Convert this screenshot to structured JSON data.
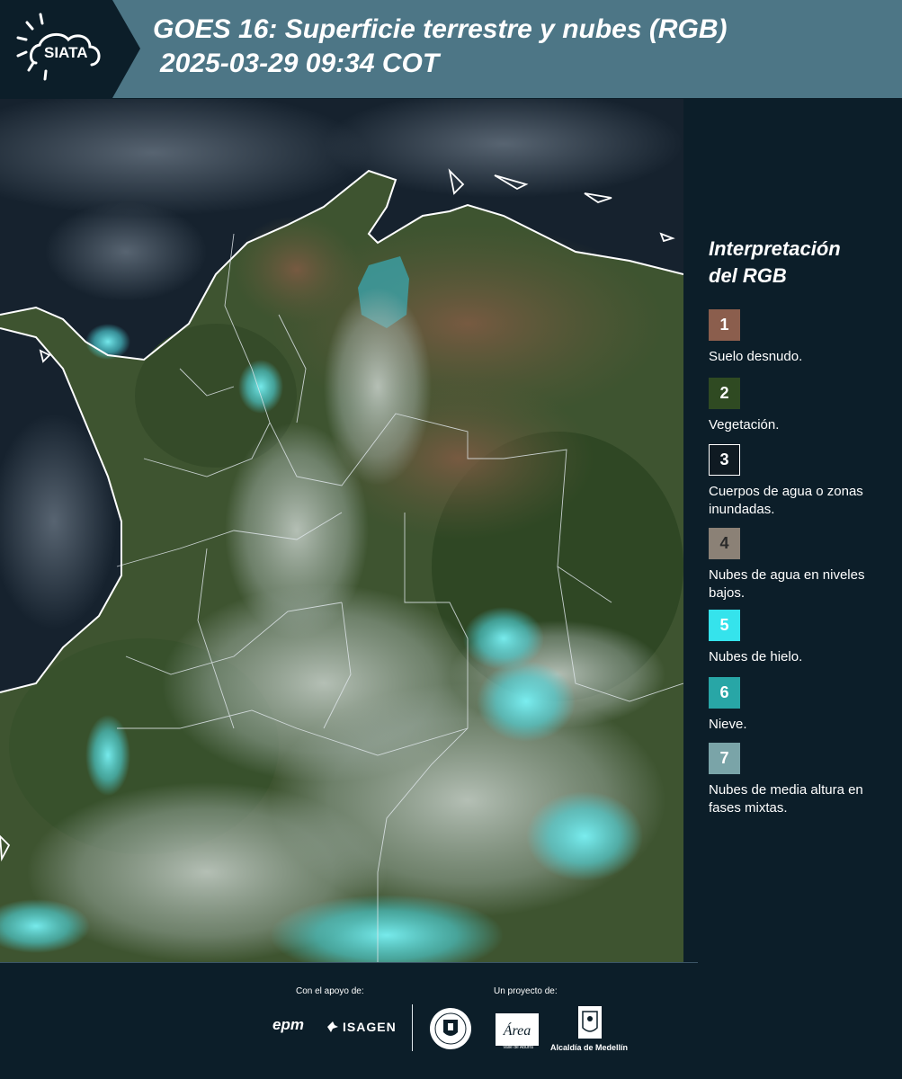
{
  "header": {
    "logo_text": "SIATA",
    "title_line1": "GOES 16: Superficie terrestre y nubes (RGB)",
    "title_line2": "2025-03-29 09:34 COT"
  },
  "legend": {
    "title_line1": "Interpretación",
    "title_line2": "del RGB",
    "items": [
      {
        "number": "1",
        "label": "Suelo desnudo.",
        "color": "#8b5e4d"
      },
      {
        "number": "2",
        "label": "Vegetación.",
        "color": "#2f4a22"
      },
      {
        "number": "3",
        "label": "Cuerpos de agua o zonas inundadas.",
        "color": "#0f1a22"
      },
      {
        "number": "4",
        "label": "Nubes de agua en niveles bajos.",
        "color": "#8b8176"
      },
      {
        "number": "5",
        "label": "Nubes de hielo.",
        "color": "#35e3ec"
      },
      {
        "number": "6",
        "label": "Nieve.",
        "color": "#28a6a6"
      },
      {
        "number": "7",
        "label": "Nubes de media altura en fases mixtas.",
        "color": "#7aa4a8"
      }
    ]
  },
  "footer": {
    "support_label": "Con el apoyo de:",
    "project_label": "Un proyecto de:",
    "epm": "epm",
    "isagen": "ISAGEN",
    "area_name": "Área",
    "area_sub": "METROPOLITANA Valle de Aburrá",
    "alcaldia": "Alcaldía de Medellín"
  },
  "colors": {
    "header_bg": "#4d7686",
    "logo_bg": "#0c1e29",
    "panel_bg": "#0c1e29"
  }
}
